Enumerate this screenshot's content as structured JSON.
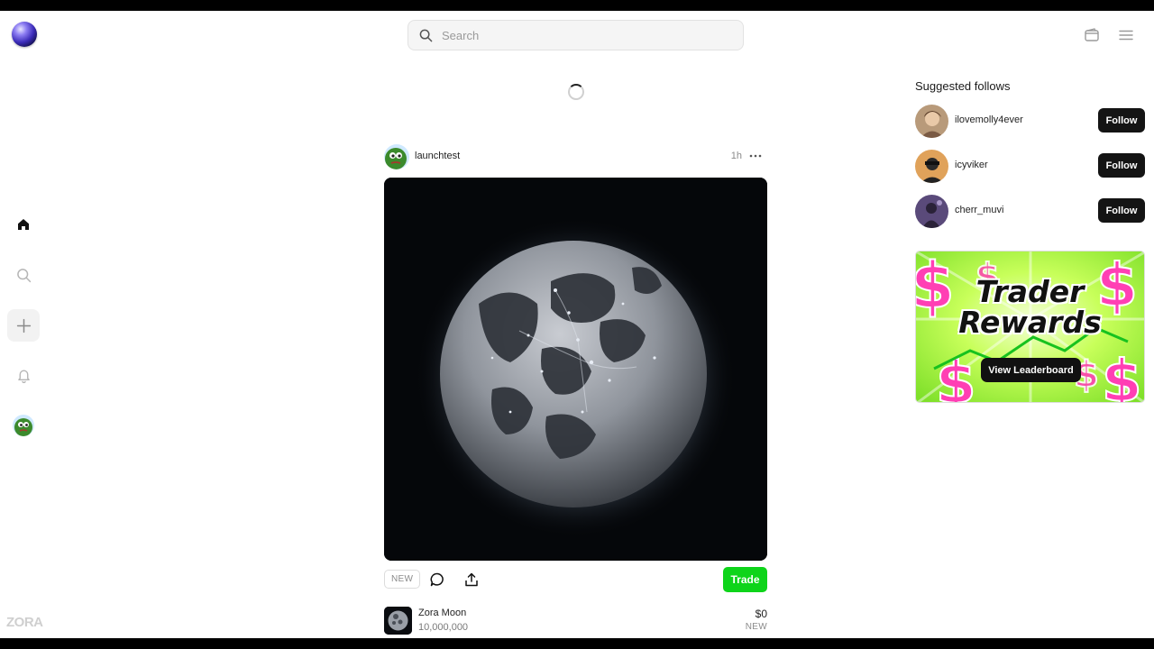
{
  "app": {
    "brand": "ZORA"
  },
  "search": {
    "placeholder": "Search"
  },
  "nav": {
    "items": [
      "home",
      "search",
      "create",
      "notifications",
      "profile"
    ]
  },
  "post": {
    "username": "launchtest",
    "time": "1h",
    "badge": "NEW",
    "trade_label": "Trade",
    "coin": {
      "name": "Zora Moon",
      "supply": "10,000,000",
      "price": "$0",
      "status": "NEW"
    }
  },
  "suggested": {
    "title": "Suggested follows",
    "follow_label": "Follow",
    "users": [
      {
        "name": "ilovemolly4ever"
      },
      {
        "name": "icyviker"
      },
      {
        "name": "cherr_muvi"
      }
    ]
  },
  "promo": {
    "line1": "Trader",
    "line2": "Rewards",
    "button": "View Leaderboard"
  },
  "colors": {
    "trade": "#0ed41a",
    "follow": "#141414",
    "promo_pink": "#ff3fb4",
    "promo_green": "#b6ff3a"
  }
}
